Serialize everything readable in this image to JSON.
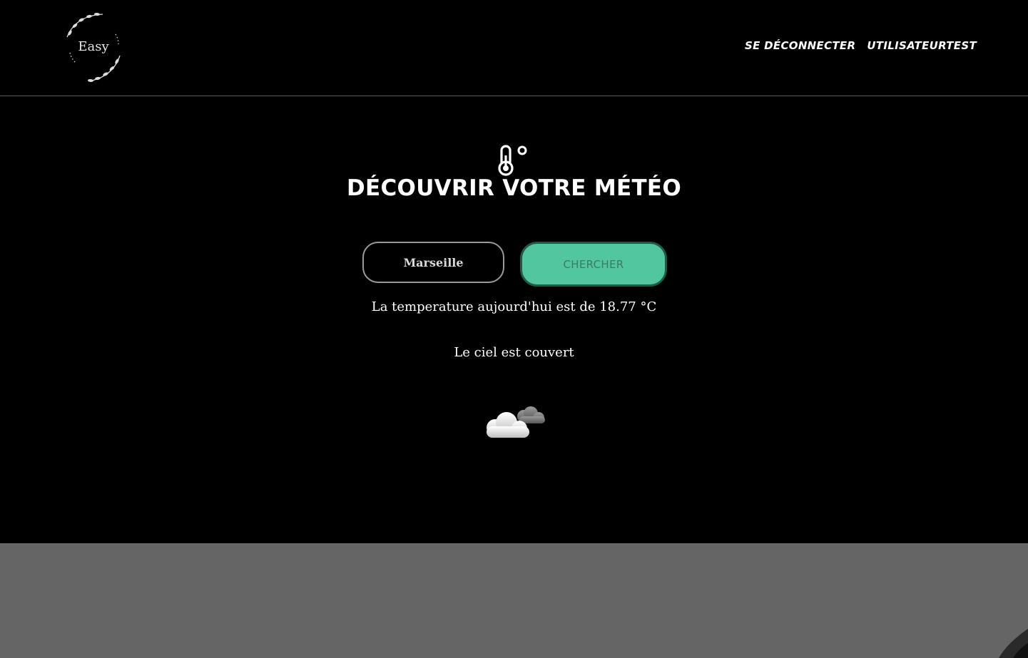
{
  "header": {
    "logo_text": "Easy",
    "nav": {
      "logout_label": "SE DÉCONNECTER",
      "user_label": "UTILISATEURTEST"
    }
  },
  "main": {
    "icon": "thermometer-degree-icon",
    "title": "DÉCOUVRIR VOTRE MÉTÉO",
    "city_input": {
      "value": "Marseille"
    },
    "search_button_label": "CHERCHER",
    "temperature_text": "La temperature aujourd'hui est de 18.77 °C",
    "sky_text": "Le ciel est couvert",
    "weather_icon": "overcast-clouds-icon"
  },
  "colors": {
    "background": "#000000",
    "accent": "#52c79f",
    "accent_border": "#1f5a48",
    "bottom_image_gray": "#656565"
  }
}
